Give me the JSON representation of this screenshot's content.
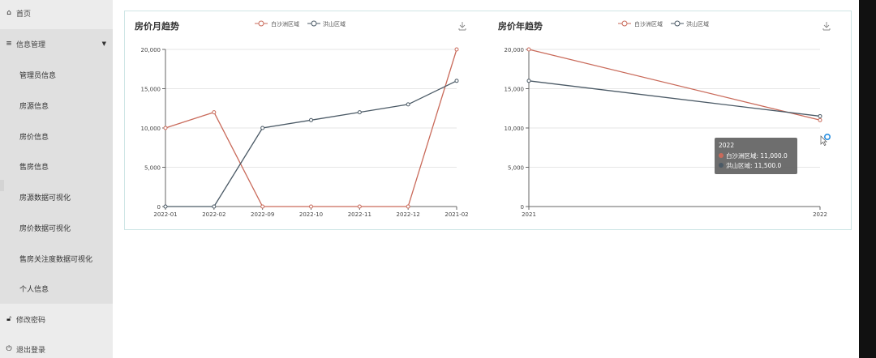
{
  "sidebar": {
    "home_label": "首页",
    "info_mgmt_label": "信息管理",
    "sub_items": [
      "管理员信息",
      "房源信息",
      "房价信息",
      "售房信息",
      "房源数据可视化",
      "房价数据可视化",
      "售房关注度数据可视化",
      "个人信息"
    ],
    "change_password_label": "修改密码",
    "logout_label": "退出登录"
  },
  "chart_data": [
    {
      "type": "line",
      "title": "房价月趋势",
      "categories": [
        "2022-01",
        "2022-02",
        "2022-09",
        "2022-10",
        "2022-11",
        "2022-12",
        "2021-02"
      ],
      "series": [
        {
          "name": "白沙洲区域",
          "color": "#c96a5a",
          "values": [
            10000,
            12000,
            0,
            0,
            0,
            0,
            20000
          ]
        },
        {
          "name": "洪山区域",
          "color": "#4b5a66",
          "values": [
            0,
            0,
            10000,
            11000,
            12000,
            13000,
            16000
          ]
        }
      ],
      "ylim": [
        0,
        20000
      ],
      "yticks": [
        "0",
        "5,000",
        "10,000",
        "15,000",
        "20,000"
      ],
      "grid": true,
      "legend": "top-center"
    },
    {
      "type": "line",
      "title": "房价年趋势",
      "categories": [
        "2021",
        "2022"
      ],
      "series": [
        {
          "name": "白沙洲区域",
          "color": "#c96a5a",
          "values": [
            20000,
            11000
          ]
        },
        {
          "name": "洪山区域",
          "color": "#4b5a66",
          "values": [
            16000,
            11500
          ]
        }
      ],
      "ylim": [
        0,
        20000
      ],
      "yticks": [
        "0",
        "5,000",
        "10,000",
        "15,000",
        "20,000"
      ],
      "grid": true,
      "legend": "top-center",
      "tooltip": {
        "title": "2022",
        "lines": [
          "白沙洲区域: 11,000.0",
          "洪山区域: 11,500.0"
        ]
      }
    }
  ]
}
